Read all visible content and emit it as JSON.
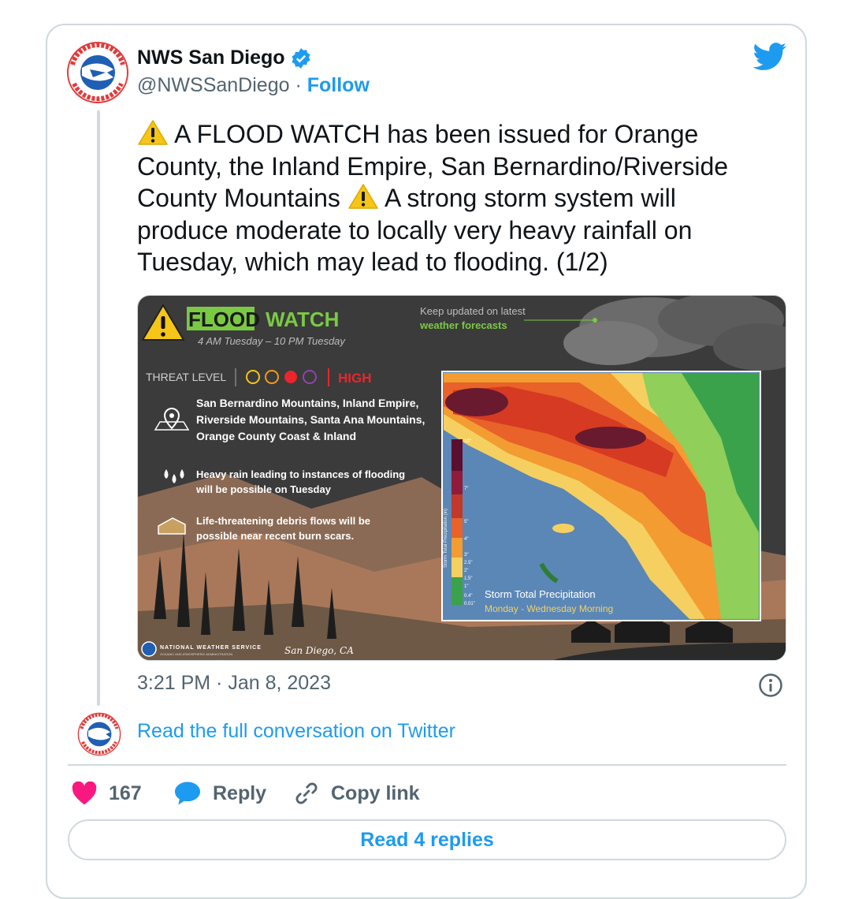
{
  "account": {
    "name": "NWS San Diego",
    "handle": "@NWSSanDiego",
    "separator": " · ",
    "follow_label": "Follow"
  },
  "tweet": {
    "text_part1": " A FLOOD WATCH has been issued for Orange County, the Inland Empire, San Bernardino/Riverside County Mountains ",
    "text_part2": " A strong storm system will produce moderate to locally very heavy rainfall on Tuesday, which may lead to flooding. (1/2)",
    "timestamp": "3:21 PM · Jan 8, 2023"
  },
  "graphic": {
    "headline_1": "FLOOD",
    "headline_2": "WATCH",
    "time_range": "4 AM Tuesday – 10 PM Tuesday",
    "keep_updated_1": "Keep updated on latest",
    "keep_updated_2": "weather forecasts",
    "threat_label": "THREAT LEVEL",
    "threat_value": "HIGH",
    "areas_1": "San Bernardino Mountains, Inland Empire,",
    "areas_2": "Riverside Mountains, Santa Ana Mountains,",
    "areas_3": "Orange County Coast & Inland",
    "rain_1": "Heavy rain leading to instances of flooding",
    "rain_2": "will be possible on Tuesday",
    "debris_1": "Life-threatening debris flows will be",
    "debris_2": "possible near recent burn scars.",
    "map_title": "Storm Total Precipitation",
    "map_subtitle": "Monday - Wednesday Morning",
    "legend_axis": "Storm Total Precipitation (in)",
    "legend_ticks": [
      "10\"",
      "7\"",
      "5\"",
      "4\"",
      "3\"",
      "2.5\"",
      "2\"",
      "1.5\"",
      "1\"",
      "0.4\"",
      "0.01\""
    ],
    "footer_org": "NATIONAL WEATHER SERVICE",
    "footer_sub": "OCEANIC AND ATMOSPHERIC ADMINISTRATION",
    "footer_city": "San Diego, CA",
    "colors": {
      "watch_green": "#7ac943",
      "high_red": "#e8262c",
      "warning_yellow": "#f5c518"
    }
  },
  "links": {
    "read_conversation": "Read the full conversation on Twitter"
  },
  "actions": {
    "like_count": "167",
    "reply_label": "Reply",
    "copy_label": "Copy link",
    "read_replies": "Read 4 replies"
  },
  "icons": [
    "nws-logo-icon",
    "verified-badge-icon",
    "twitter-bird-icon",
    "warning-icon",
    "info-icon",
    "heart-icon",
    "reply-bubble-icon",
    "link-icon"
  ],
  "colors": {
    "accent": "#1d9bf0",
    "like": "#f91880",
    "text_secondary": "#536471",
    "border": "#cfd9de"
  }
}
